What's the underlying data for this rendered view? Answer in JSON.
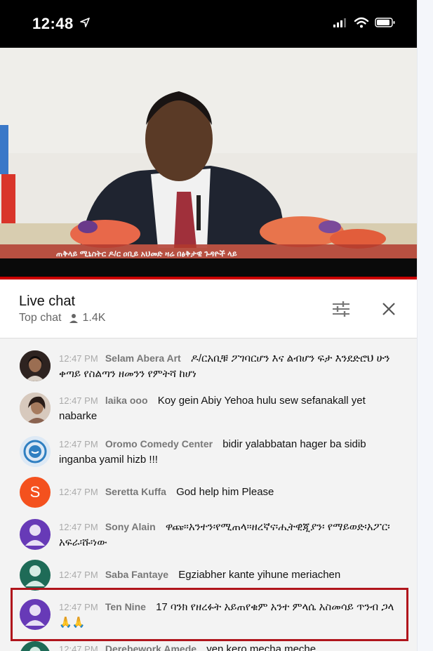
{
  "status_bar": {
    "time": "12:48"
  },
  "video": {
    "caption": "ጠቅላይ ሚኒስትር ዶ/ር ዐቢይ አህመድ ዛሬ በፅቅታዊ ጉዳዮች ላይ"
  },
  "chat": {
    "title": "Live chat",
    "mode": "Top chat",
    "viewers": "1.4K",
    "messages": [
      {
        "time": "12:47 PM",
        "author": "Selam Abera Art",
        "text": "ዶ/ርአቢቹ ፖገባርሆን እና ልብሆን ፍታ እንደድሮህ ሁን ቀጣይ የስልጣን ዘመንን የምትሻ ከሆነ",
        "avatar": "photo"
      },
      {
        "time": "12:47 PM",
        "author": "laika ooo",
        "text": "Koy gein Abiy Yehoa hulu sew sefanakall yet nabarke",
        "avatar": "photo"
      },
      {
        "time": "12:47 PM",
        "author": "Oromo Comedy Center",
        "text": "bidir yalabbatan hager ba sidib inganba yamil hizb !!!",
        "avatar": "logo"
      },
      {
        "time": "12:47 PM",
        "author": "Seretta Kuffa",
        "text": "God help him Please",
        "avatar": "S"
      },
      {
        "time": "12:47 PM",
        "author": "Sony Alain",
        "text": "ዋጩ።አንተን፡የሚጠላ።ዘረኛና፡ሒትዊጂያን፡ የማይወድ፡አፖር፡አፍራ፡ሹ፡ነው",
        "avatar": "default"
      },
      {
        "time": "12:47 PM",
        "author": "Saba Fantaye",
        "text": "Egziabher kante yihune meriachen",
        "avatar": "default"
      },
      {
        "time": "12:47 PM",
        "author": "Ten Nine",
        "text": "17 ባንክ የዘረፉት አይጠየቁም አንተ ምላሴ አስመሳይ ጥንብ ጋላ 🙏🙏",
        "avatar": "default"
      },
      {
        "time": "12:47 PM",
        "author": "Derebework Amede",
        "text": "yen kero mecha meche",
        "avatar": "default"
      }
    ]
  },
  "colors": {
    "progress": "#cc0000",
    "highlight": "#b0151c",
    "avatar_orange": "#f4511e",
    "avatar_purple": "#673ab7",
    "avatar_teal": "#1e6b57"
  }
}
